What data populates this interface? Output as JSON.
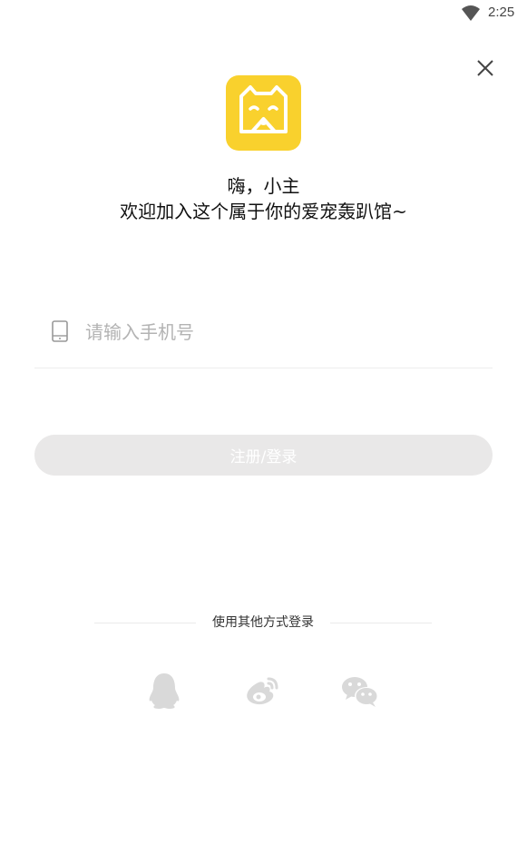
{
  "status_bar": {
    "time": "2:25",
    "wifi_icon": "wifi-icon"
  },
  "header": {
    "close_icon": "close-icon"
  },
  "logo": {
    "icon": "dog-face-logo",
    "color": "#F9D12D"
  },
  "greeting": {
    "line1": "嗨，小主",
    "line2": "欢迎加入这个属于你的爱宠轰趴馆~"
  },
  "phone": {
    "icon": "phone-icon",
    "value": "",
    "placeholder": "请输入手机号"
  },
  "login_button": {
    "label": "注册/登录"
  },
  "other_login": {
    "label": "使用其他方式登录",
    "options": [
      {
        "name": "qq",
        "icon": "qq-icon"
      },
      {
        "name": "weibo",
        "icon": "weibo-icon"
      },
      {
        "name": "wechat",
        "icon": "wechat-icon"
      }
    ]
  }
}
